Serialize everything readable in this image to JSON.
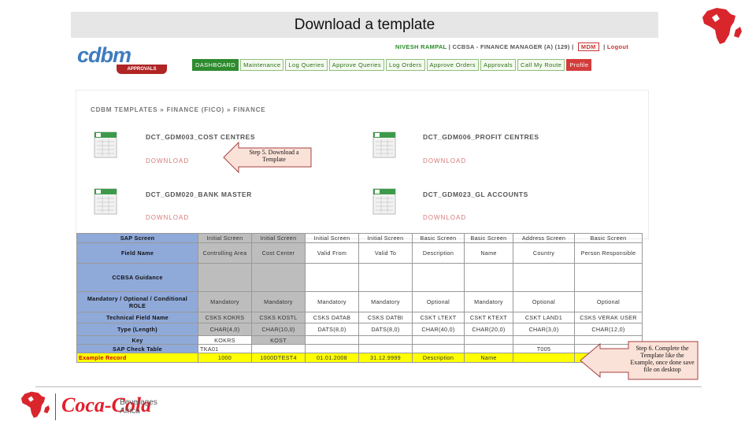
{
  "slide": {
    "title": "Download a template"
  },
  "app": {
    "user": "NIVESH RAMPAL",
    "company": "CCBSA - FINANCE MANAGER (A) (129)",
    "separator": "|",
    "mdm": "MDM",
    "logout": "Logout",
    "logo_text": "cdbm",
    "approvals_badge": "APPROVALS",
    "nav": [
      "DASHBOARD",
      "Maintenance",
      "Log Queries",
      "Approve Queries",
      "Log Orders",
      "Approve Orders",
      "Approvals",
      "Call My Route",
      "Profile"
    ],
    "breadcrumb": "CDBM TEMPLATES » FINANCE (FICO) » FINANCE",
    "templates": [
      {
        "name": "DCT_GDM003_COST CENTRES",
        "download": "DOWNLOAD"
      },
      {
        "name": "DCT_GDM006_PROFIT CENTRES",
        "download": "DOWNLOAD"
      },
      {
        "name": "DCT_GDM020_BANK MASTER",
        "download": "DOWNLOAD"
      },
      {
        "name": "DCT_GDM023_GL ACCOUNTS",
        "download": "DOWNLOAD"
      }
    ]
  },
  "callouts": {
    "step5": "Step 5. Download a Template",
    "step6": "Step 6. Complete the Template like the Example, once done save file on desktop"
  },
  "table": {
    "rows": [
      [
        "SAP Screen",
        "Initial Screen",
        "Initial Screen",
        "Initial Screen",
        "Initial Screen",
        "Basic Screen",
        "Basic Screen",
        "Address Screen",
        "Basic Screen"
      ],
      [
        "Field Name",
        "Controlling Area",
        "Cost Center",
        "Valid From",
        "Valid To",
        "Description",
        "Name",
        "Country",
        "Person Responsible"
      ],
      [
        "CCBSA Guidance",
        "",
        "",
        "",
        "",
        "",
        "",
        "",
        ""
      ],
      [
        "Mandatory / Optional / Conditional ROLE",
        "Mandatory",
        "Mandatory",
        "Mandatory",
        "Mandatory",
        "Optional",
        "Mandatory",
        "Optional",
        "Optional"
      ],
      [
        "Technical Field Name",
        "CSKS KOKRS",
        "CSKS KOSTL",
        "CSKS DATAB",
        "CSKS DATBI",
        "CSKT LTEXT",
        "CSKT KTEXT",
        "CSKT LAND1",
        "CSKS VERAK USER"
      ],
      [
        "Type (Length)",
        "CHAR(4,0)",
        "CHAR(10,0)",
        "DATS(8,0)",
        "DATS(8,0)",
        "CHAR(40,0)",
        "CHAR(20,0)",
        "CHAR(3,0)",
        "CHAR(12,0)"
      ],
      [
        "Key",
        "KOKRS",
        "KOST",
        "",
        "",
        "",
        "",
        "",
        ""
      ],
      [
        "SAP Check Table",
        "TKA01",
        "",
        "",
        "",
        "",
        "",
        "T005",
        ""
      ],
      [
        "Example Record",
        "1000",
        "1000DTEST4",
        "01.01.2008",
        "31.12.9999",
        "Description",
        "Name",
        "",
        ""
      ]
    ]
  },
  "footer": {
    "brand": "Coca-Cola",
    "brand_line1": "Beverages",
    "brand_line2": "Africa"
  },
  "colors": {
    "approvals_red": "#b02525",
    "dashboard_green": "#2e8b2e",
    "label_blue": "#8fa9d9",
    "example_yellow": "#ffff00",
    "coke_red": "#e41e2b"
  }
}
